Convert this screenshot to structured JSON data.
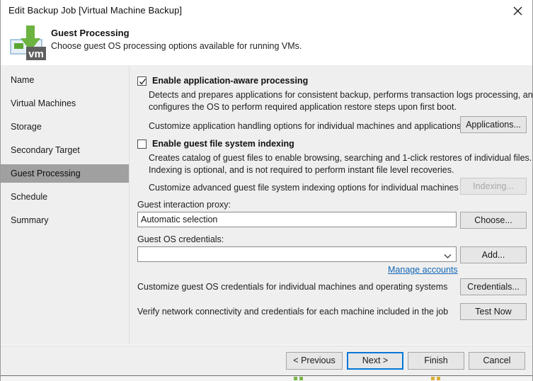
{
  "window": {
    "title": "Edit Backup Job [Virtual Machine Backup]",
    "close_icon": "close-icon"
  },
  "header": {
    "title": "Guest Processing",
    "subtitle": "Choose guest OS processing options available for running VMs.",
    "icon": "vm-backup-icon",
    "icon_badge_text": "vm"
  },
  "sidebar": {
    "items": [
      {
        "label": "Name",
        "selected": false
      },
      {
        "label": "Virtual Machines",
        "selected": false
      },
      {
        "label": "Storage",
        "selected": false
      },
      {
        "label": "Secondary Target",
        "selected": false
      },
      {
        "label": "Guest Processing",
        "selected": true
      },
      {
        "label": "Schedule",
        "selected": false
      },
      {
        "label": "Summary",
        "selected": false
      }
    ]
  },
  "main": {
    "app_aware": {
      "checkbox_label": "Enable application-aware processing",
      "checked": true,
      "desc_line1": "Detects and prepares applications for consistent backup, performs transaction logs processing, and",
      "desc_line2": "configures the OS to perform required application restore steps upon first boot.",
      "customize_text": "Customize application handling options for individual machines and applications",
      "button_label": "Applications...",
      "button_enabled": true
    },
    "indexing": {
      "checkbox_label": "Enable guest file system indexing",
      "checked": false,
      "desc_line1": "Creates catalog of guest files to enable browsing, searching and 1-click restores of individual files.",
      "desc_line2": "Indexing is optional, and is not required to perform instant file level recoveries.",
      "customize_text": "Customize advanced guest file system indexing options for individual machines",
      "button_label": "Indexing...",
      "button_enabled": false
    },
    "proxy": {
      "label": "Guest interaction proxy:",
      "value": "Automatic selection",
      "button_label": "Choose..."
    },
    "credentials": {
      "label": "Guest OS credentials:",
      "value": "",
      "dropdown_icon": "chevron-down-icon",
      "button_label": "Add...",
      "manage_link": "Manage accounts"
    },
    "customize_credentials": {
      "text": "Customize guest OS credentials for individual machines and operating systems",
      "button_label": "Credentials..."
    },
    "verify": {
      "text": "Verify network connectivity and credentials for each machine included in the job",
      "button_label": "Test Now"
    }
  },
  "footer": {
    "previous_label": "< Previous",
    "next_label": "Next >",
    "finish_label": "Finish",
    "cancel_label": "Cancel",
    "focused_button": "Next >"
  }
}
